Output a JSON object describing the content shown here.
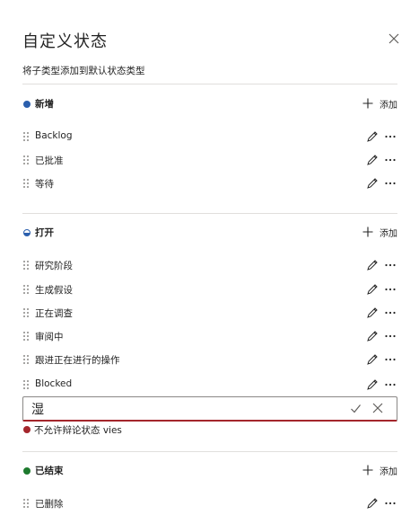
{
  "dialog": {
    "title": "自定义状态",
    "subtitle": "将子类型添加到默认状态类型"
  },
  "sections": [
    {
      "label": "新增",
      "dot_color": "#2b5fad",
      "add_label": "添加",
      "items": [
        "Backlog",
        "已批准",
        "等待"
      ]
    },
    {
      "label": "打开",
      "dot_color": "#2b5fad",
      "add_label": "添加",
      "items": [
        "研究阶段",
        "生成假设",
        "正在调查",
        "审阅中",
        "跟进正在进行的操作",
        "Blocked"
      ]
    },
    {
      "label": "已结束",
      "dot_color": "#1e7a2e",
      "add_label": "添加",
      "items": [
        "已删除"
      ]
    }
  ],
  "edit_field": {
    "value": "湿",
    "error": "不允许辩论状态 vies",
    "error_color": "#a4262c"
  },
  "icons": {
    "close": "close-icon",
    "plus": "plus-icon",
    "edit": "pencil-icon",
    "more": "more-icon",
    "grip": "drag-handle-icon",
    "confirm": "checkmark-icon",
    "cancel": "cancel-icon"
  }
}
